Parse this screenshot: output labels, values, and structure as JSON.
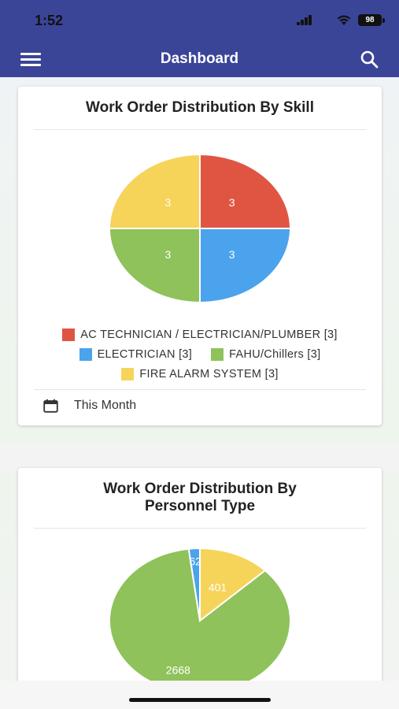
{
  "status_bar": {
    "time": "1:52",
    "battery": "98",
    "icons": [
      "signal-icon",
      "wifi-icon",
      "battery-icon"
    ]
  },
  "app_bar": {
    "title": "Dashboard",
    "left_icon": "menu-icon",
    "right_icon": "search-icon"
  },
  "cards": [
    {
      "title": "Work Order Distribution By Skill",
      "legend_rows": [
        [
          {
            "label": "AC TECHNICIAN / ELECTRICIAN/PLUMBER [3]",
            "color": "#e05542"
          }
        ],
        [
          {
            "label": "ELECTRICIAN [3]",
            "color": "#4aa3ec"
          },
          {
            "label": "FAHU/Chillers [3]",
            "color": "#8fc25a"
          }
        ],
        [
          {
            "label": "FIRE ALARM SYSTEM [3]",
            "color": "#f6d45a"
          }
        ]
      ],
      "footer": {
        "icon": "calendar-icon",
        "label": "This Month"
      }
    },
    {
      "title": "Work Order Distribution By Personnel Type"
    }
  ],
  "chart_data": [
    {
      "type": "pie",
      "title": "Work Order Distribution By Skill",
      "categories": [
        "AC TECHNICIAN / ELECTRICIAN/PLUMBER",
        "ELECTRICIAN",
        "FAHU/Chillers",
        "FIRE ALARM SYSTEM"
      ],
      "values": [
        3,
        3,
        3,
        3
      ],
      "colors": [
        "#e05542",
        "#4aa3ec",
        "#8fc25a",
        "#f6d45a"
      ],
      "data_labels": [
        "3",
        "3",
        "3",
        "3"
      ],
      "legend": "bottom"
    },
    {
      "type": "pie",
      "title": "Work Order Distribution By Personnel Type",
      "categories": [
        "",
        "",
        ""
      ],
      "values": [
        401,
        2668,
        62
      ],
      "colors": [
        "#f6d45a",
        "#8fc25a",
        "#4aa3ec"
      ],
      "data_labels": [
        "401",
        "2668",
        "62"
      ]
    }
  ]
}
